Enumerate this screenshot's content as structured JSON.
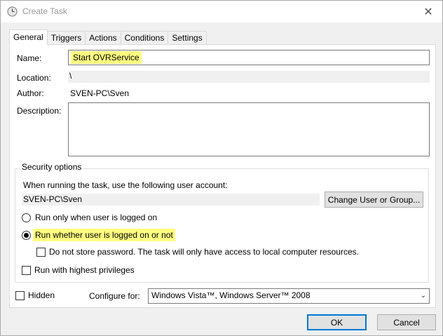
{
  "window": {
    "title": "Create Task",
    "close_glyph": "✕"
  },
  "tabs": [
    {
      "label": "General",
      "active": true
    },
    {
      "label": "Triggers",
      "active": false
    },
    {
      "label": "Actions",
      "active": false
    },
    {
      "label": "Conditions",
      "active": false
    },
    {
      "label": "Settings",
      "active": false
    }
  ],
  "general": {
    "name_label": "Name:",
    "name_value": "Start OVRService",
    "location_label": "Location:",
    "location_value": "\\",
    "author_label": "Author:",
    "author_value": "SVEN-PC\\Sven",
    "description_label": "Description:",
    "description_value": ""
  },
  "security": {
    "title": "Security options",
    "account_prompt": "When running the task, use the following user account:",
    "account_value": "SVEN-PC\\Sven",
    "change_button": "Change User or Group...",
    "radio_logged_on": "Run only when user is logged on",
    "radio_logged_on_checked": false,
    "radio_whether": "Run whether user is logged on or not",
    "radio_whether_checked": true,
    "no_store_password": "Do not store password.  The task will only have access to local computer resources.",
    "no_store_password_checked": false,
    "highest_privileges": "Run with highest privileges",
    "highest_privileges_checked": false
  },
  "footer": {
    "hidden_label": "Hidden",
    "hidden_checked": false,
    "configure_label": "Configure for:",
    "configure_value": "Windows Vista™, Windows Server™ 2008",
    "dropdown_glyph": "⌄",
    "ok_button": "OK",
    "cancel_button": "Cancel"
  },
  "colors": {
    "highlight": "#fdfd80",
    "accent_border": "#0078d7"
  }
}
